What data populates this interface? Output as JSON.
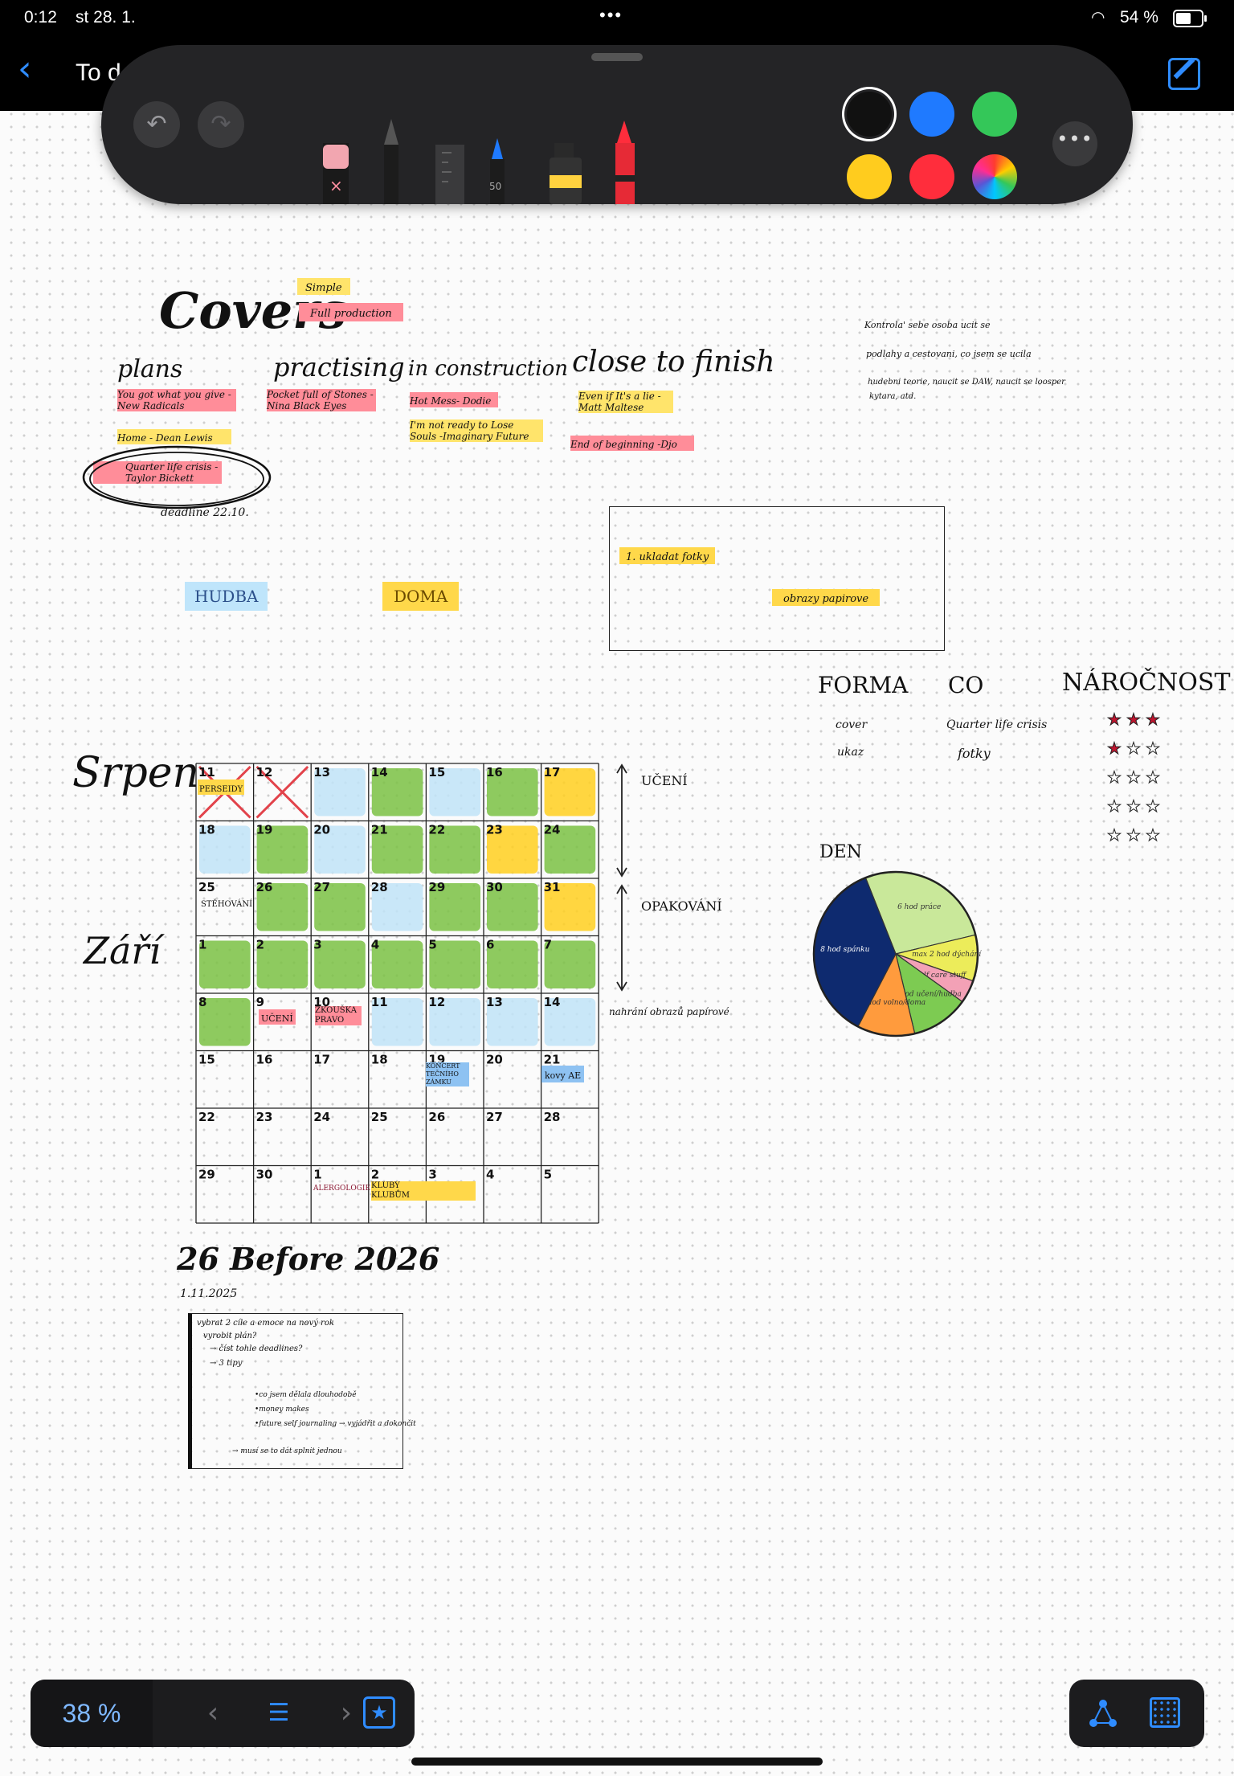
{
  "status": {
    "time": "0:12",
    "date": "st 28. 1.",
    "battery": "54 %",
    "dots": "•••",
    "battery_level": 0.54
  },
  "nav": {
    "back": "‹",
    "title": "To d"
  },
  "toolbar": {
    "undo": "↶",
    "redo": "↷",
    "pen_size": "50",
    "eraser_mark": "×",
    "more": "•••",
    "colors": [
      "#111111",
      "#1f7aff",
      "#34c759",
      "#ffcc1e",
      "#ff2d3c"
    ],
    "icons": [
      "undo-icon",
      "redo-icon",
      "eraser-icon",
      "pencil-icon",
      "ruler-icon",
      "pen-icon",
      "marker-icon",
      "crayon-icon",
      "color-wheel-icon",
      "more-icon"
    ]
  },
  "covers": {
    "title": "Covers",
    "legend": [
      "Simple",
      "Full production"
    ],
    "columns": [
      {
        "heading": "plans",
        "items": [
          "You got what you give -New Radicals",
          "Home - Dean Lewis",
          "Quarter life crisis -Taylor Bickett"
        ],
        "note": "deadline 22.10."
      },
      {
        "heading": "practising",
        "items": [
          "Pocket full of Stones -Nina Black Eyes"
        ]
      },
      {
        "heading": "in construction",
        "items": [
          "Hot Mess- Dodie",
          "I'm not ready to Lose Souls -Imaginary Future"
        ]
      },
      {
        "heading": "close to finish",
        "items": [
          "Even if It's a lie -Matt Maltese",
          "End of beginning -Djo"
        ]
      }
    ]
  },
  "top_note": {
    "lines": [
      "Kontrola' sebe osoba ucit se",
      "podlahy a cestovani, co jsem se ucila",
      "hudebni teorie, naucit se DAW, naucit se loosper",
      "kytara, atd."
    ]
  },
  "tags": {
    "hudba": "HUDBA",
    "doma": "DOMA"
  },
  "box": {
    "item1": "1. ukladat fotky",
    "item2": "obrazy papirove"
  },
  "table": {
    "headers": [
      "FORMA",
      "CO",
      "NÁROČNOST"
    ],
    "rows": [
      {
        "forma": "cover",
        "co": "Quarter life crisis",
        "stars": 3
      },
      {
        "forma": "ukaz",
        "co": "fotky",
        "stars": 1
      },
      {
        "forma": "",
        "co": "",
        "stars": 0
      },
      {
        "forma": "",
        "co": "",
        "stars": 0
      },
      {
        "forma": "",
        "co": "",
        "stars": 0
      }
    ]
  },
  "months": {
    "srpen": "Srpen",
    "zari": "Září"
  },
  "calendar": {
    "days": [
      [
        "11",
        "12",
        "13",
        "14",
        "15",
        "16",
        "17"
      ],
      [
        "18",
        "19",
        "20",
        "21",
        "22",
        "23",
        "24"
      ],
      [
        "25",
        "26",
        "27",
        "28",
        "29",
        "30",
        "31"
      ],
      [
        "1",
        "2",
        "3",
        "4",
        "5",
        "6",
        "7"
      ],
      [
        "8",
        "9",
        "10",
        "11",
        "12",
        "13",
        "14"
      ],
      [
        "15",
        "16",
        "17",
        "18",
        "19",
        "20",
        "21"
      ],
      [
        "22",
        "23",
        "24",
        "25",
        "26",
        "27",
        "28"
      ],
      [
        "29",
        "30",
        "1",
        "2",
        "3",
        "4",
        "5"
      ]
    ],
    "notes": {
      "r0c0": "PERSEIDY",
      "r2c0": "STĚHOVÁNÍ",
      "r4c1": "UČENÍ",
      "r4c2": "ZKOUŠKA PRAVO",
      "r5c3": "KONCERT TEČNÍHO ZÁMKU",
      "r5c6": "kovy AE",
      "r7c2": "ALERGOLOGIE",
      "r7c3": "KLUBY KLUBŮM"
    },
    "side_labels": {
      "uceni": "UČENÍ",
      "opakovani": "OPAKOVÁNÍ",
      "nahrat": "nahrání obrazů papírové"
    }
  },
  "pie": {
    "title": "DEN",
    "segments": [
      {
        "label": "6 hod práce",
        "hours": 6,
        "color": "#c9e89a"
      },
      {
        "label": "max 2 hod dýchání",
        "hours": 2,
        "color": "#ecec5a"
      },
      {
        "label": "self care stuff",
        "hours": 1,
        "color": "#f3a1b6"
      },
      {
        "label": "2,5 hod učení/hudba",
        "hours": 2.5,
        "color": "#7dcb52"
      },
      {
        "label": "2,5 hod volno/doma",
        "hours": 2.5,
        "color": "#ff9b3d"
      },
      {
        "label": "8 hod spánku",
        "hours": 8,
        "color": "#0e2a6f"
      }
    ]
  },
  "plan2026": {
    "title": "26 Before 2026",
    "date": "1.11.2025",
    "lines": [
      "vybrat 2 cíle a emoce na nový rok",
      "vyrobit plán?",
      "→ číst tohle deadlines?",
      "→ 3 tipy",
      "•co jsem dělala dlouhodobě",
      "•money makes",
      "•future self journaling → vyjádřit a dokončit",
      "→ musí se to dát splnit jednou"
    ]
  },
  "bottom": {
    "zoom": "38 %",
    "prev": "‹",
    "list": "☰",
    "next": "›",
    "bookmark": "★",
    "icons": [
      "shapes-icon",
      "grid-icon"
    ]
  }
}
